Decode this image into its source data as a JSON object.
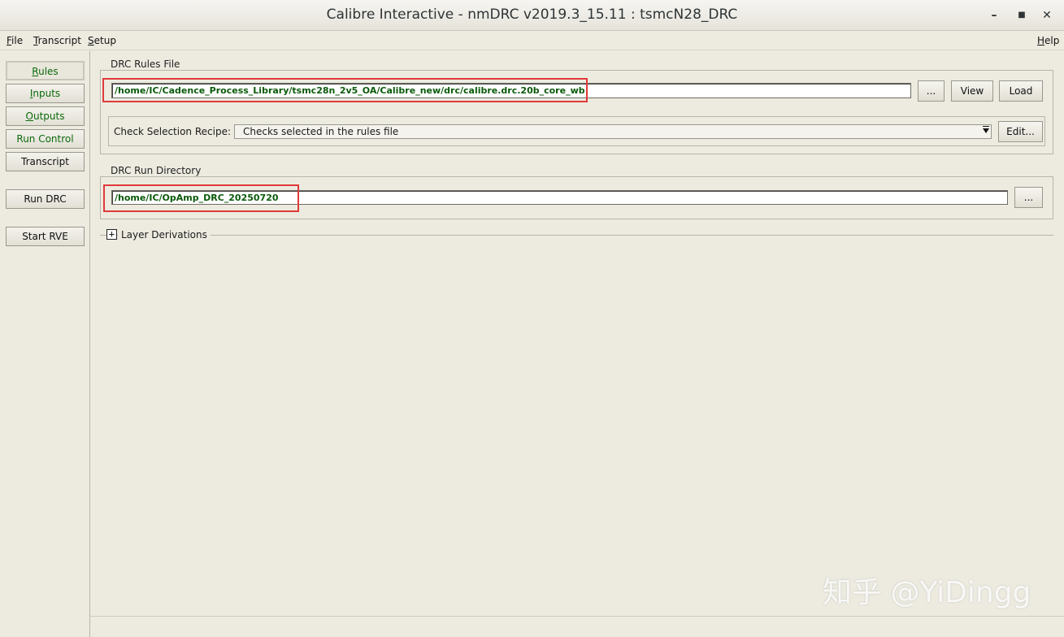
{
  "window": {
    "title": "Calibre Interactive - nmDRC v2019.3_15.11 : tsmcN28_DRC",
    "minimize": "–",
    "maximize": "■",
    "close": "✕"
  },
  "menu": {
    "file": "File",
    "transcript": "Transcript",
    "setup": "Setup",
    "help": "Help"
  },
  "nav": {
    "rules": "Rules",
    "inputs": "Inputs",
    "outputs": "Outputs",
    "run_control": "Run Control",
    "transcript": "Transcript",
    "run_drc": "Run DRC",
    "start_rve": "Start RVE"
  },
  "rules_file": {
    "group_label": "DRC Rules File",
    "path": "/home/IC/Cadence_Process_Library/tsmc28n_2v5_OA/Calibre_new/drc/calibre.drc.20b_core_wb",
    "browse": "...",
    "view": "View",
    "load": "Load",
    "recipe_label": "Check Selection Recipe:",
    "recipe_value": "Checks selected in the rules file",
    "edit": "Edit..."
  },
  "run_directory": {
    "group_label": "DRC Run Directory",
    "path": "/home/IC/OpAmp_DRC_20250720",
    "browse": "..."
  },
  "layer_derivations": {
    "expand": "+",
    "label": "Layer Derivations"
  },
  "watermark": "知乎 @YiDingg",
  "colors": {
    "highlight": "#e03a3a",
    "path_text": "#0a5a0a",
    "nav_green": "#0a6a0a"
  }
}
